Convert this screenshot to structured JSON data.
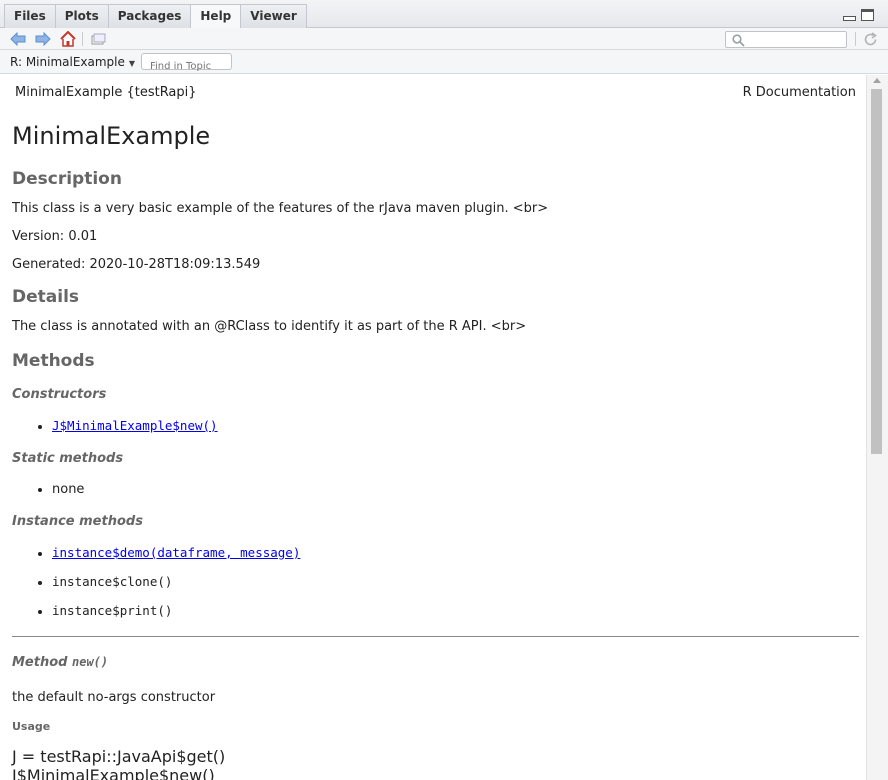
{
  "tabs": [
    {
      "label": "Files"
    },
    {
      "label": "Plots"
    },
    {
      "label": "Packages"
    },
    {
      "label": "Help"
    },
    {
      "label": "Viewer"
    }
  ],
  "active_tab": "Help",
  "toolbar": {
    "search_value": "",
    "icons": [
      "back-arrow-icon",
      "forward-arrow-icon",
      "home-icon",
      "popout-icon",
      "search-icon",
      "refresh-icon"
    ]
  },
  "topicbar": {
    "topic_label": "R: MinimalExample",
    "find_placeholder": "Find in Topic"
  },
  "doc": {
    "header_left": "MinimalExample {testRapi}",
    "header_right": "R Documentation",
    "title": "MinimalExample",
    "description_heading": "Description",
    "description_text": "This class is a very basic example of the features of the rJava maven plugin. <br>",
    "version_text": "Version: 0.01",
    "generated_text": "Generated: 2020-10-28T18:09:13.549",
    "details_heading": "Details",
    "details_text": "The class is annotated with an @RClass to identify it as part of the R API. <br>",
    "methods_heading": "Methods",
    "constructors_heading": "Constructors",
    "constructors": [
      "J$MinimalExample$new()"
    ],
    "static_heading": "Static methods",
    "static_methods": [
      "none"
    ],
    "instance_heading": "Instance methods",
    "instance_methods": [
      {
        "label": "instance$demo(dataframe, message)",
        "link": true
      },
      {
        "label": "instance$clone()",
        "link": false
      },
      {
        "label": "instance$print()",
        "link": false
      }
    ],
    "method_prefix": "Method",
    "method_name": "new()",
    "method_desc": "the default no-args constructor",
    "usage_heading": "Usage",
    "usage_line1": "J = testRapi::JavaApi$get()",
    "usage_line2": "J$MinimalExample$new()"
  },
  "colors": {
    "link": "#0000ee",
    "heading_gray": "#666666",
    "home_icon": "#c0392b",
    "nav_arrow": "#5b8fd1"
  }
}
